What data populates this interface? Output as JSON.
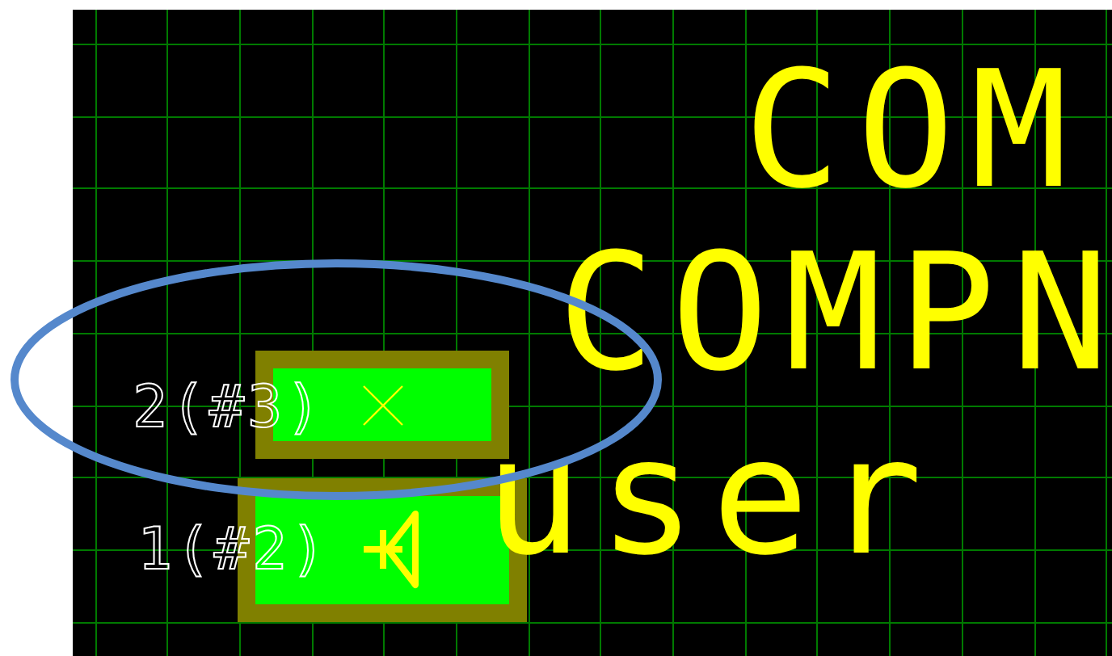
{
  "layout_canvas": {
    "text_lines": [
      "COM",
      "COMPN",
      "user"
    ],
    "pads": [
      {
        "label": "2(#3)",
        "kind": "cross"
      },
      {
        "label": "1(#2)",
        "kind": "triangle"
      }
    ]
  }
}
